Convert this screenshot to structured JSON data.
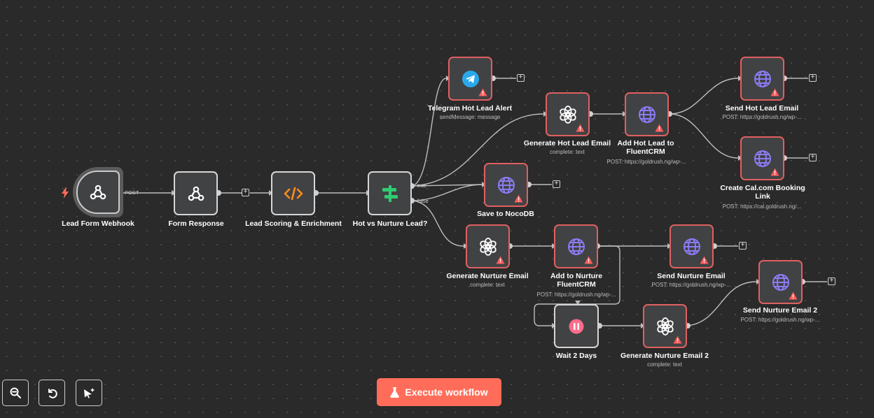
{
  "nodes": {
    "lead_form_webhook": {
      "label": "Lead Form Webhook",
      "icon": "webhook-icon"
    },
    "form_response": {
      "label": "Form Response",
      "icon": "webhook-icon"
    },
    "lead_scoring": {
      "label": "Lead Scoring & Enrichment",
      "icon": "code-icon"
    },
    "hot_vs_nurture": {
      "label": "Hot vs Nurture Lead?",
      "icon": "switch-icon"
    },
    "telegram_alert": {
      "label": "Telegram Hot Lead Alert",
      "sub": "sendMessage: message",
      "icon": "telegram-icon"
    },
    "generate_hot_email": {
      "label": "Generate Hot Lead Email",
      "sub": "complete: text",
      "icon": "openai-icon"
    },
    "add_hot_fluentcrm": {
      "label": "Add Hot Lead to FluentCRM",
      "sub": "POST: https://goldrush.ng/wp-...",
      "icon": "globe-icon"
    },
    "send_hot_email": {
      "label": "Send Hot Lead Email",
      "sub": "POST: https://goldrush.ng/wp-...",
      "icon": "globe-icon"
    },
    "create_cal_link": {
      "label": "Create Cal.com Booking Link",
      "sub": "POST: https://cal.goldrush.ng/...",
      "icon": "globe-icon"
    },
    "save_nocodb": {
      "label": "Save to NocoDB",
      "icon": "globe-icon"
    },
    "generate_nurture_email": {
      "label": "Generate Nurture Email",
      "sub": "complete: text",
      "icon": "openai-icon"
    },
    "add_nurture_fluentcrm": {
      "label": "Add to Nurture FluentCRM",
      "sub": "POST: https://goldrush.ng/wp-...",
      "icon": "globe-icon"
    },
    "send_nurture_email": {
      "label": "Send Nurture Email",
      "sub": "POST: https://goldrush.ng/wp-...",
      "icon": "globe-icon"
    },
    "wait_2_days": {
      "label": "Wait 2 Days",
      "icon": "pause-icon"
    },
    "generate_nurture_email_2": {
      "label": "Generate Nurture Email 2",
      "sub": "complete: text",
      "icon": "openai-icon"
    },
    "send_nurture_email_2": {
      "label": "Send Nurture Email 2",
      "sub": "POST: https://goldrush.ng/wp-...",
      "icon": "globe-icon"
    }
  },
  "edge_labels": {
    "post": "POST",
    "true": "true",
    "false": "false"
  },
  "controls": {
    "zoom_out": "zoom-out-icon",
    "reset": "undo-icon",
    "tidy": "tidy-icon"
  },
  "execute_button": {
    "label": "Execute workflow",
    "icon": "flask-icon"
  },
  "colors": {
    "canvas": "#2a2a2a",
    "node_bg": "#414244",
    "error_border": "#e06060",
    "accent": "#ff6d5a",
    "globe": "#8b7cf6",
    "telegram": "#29a9eb",
    "code": "#ff8c1a",
    "switch": "#2ecc71",
    "wait": "#ff6b8a"
  }
}
